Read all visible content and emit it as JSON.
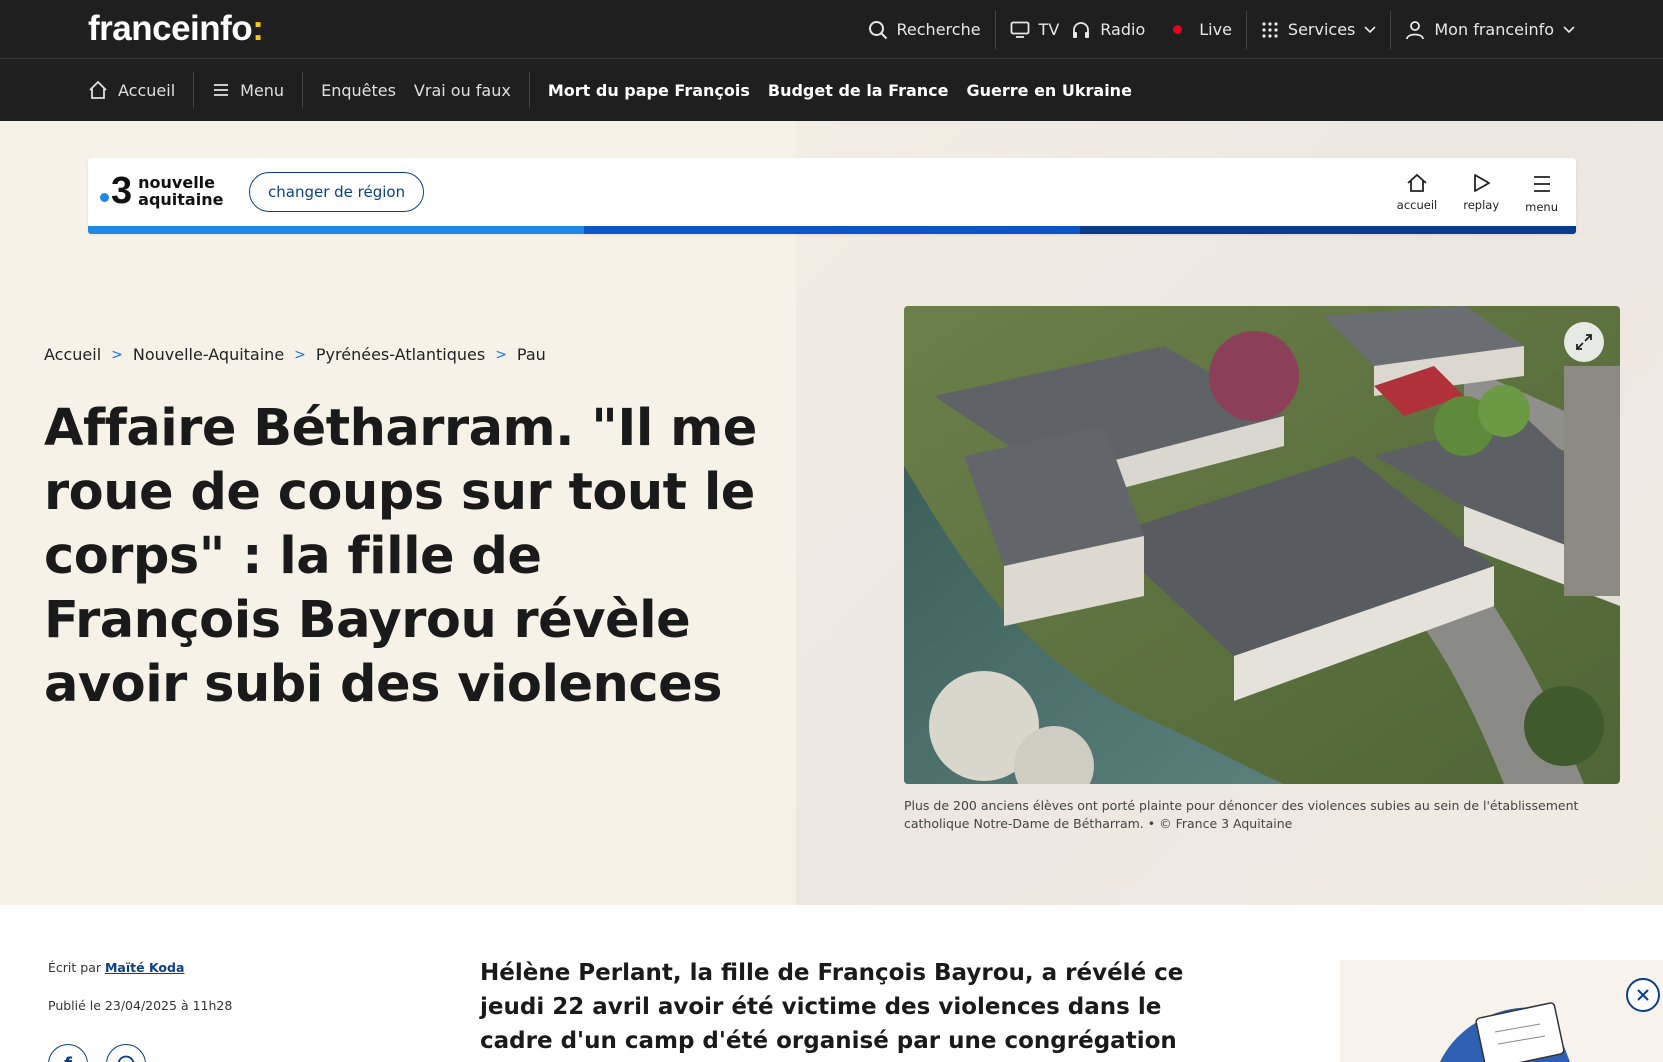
{
  "header": {
    "logo_text": "franceinfo",
    "logo_colon": ":",
    "search_label": "Recherche",
    "tv_label": "TV",
    "radio_label": "Radio",
    "live_label": "Live",
    "services_label": "Services",
    "account_label": "Mon franceinfo"
  },
  "nav": {
    "home": "Accueil",
    "menu": "Menu",
    "items": [
      "Enquêtes",
      "Vrai ou faux"
    ],
    "highlights": [
      "Mort du pape François",
      "Budget de la France",
      "Guerre en Ukraine"
    ]
  },
  "region": {
    "channel_number": "3",
    "name_line1": "nouvelle",
    "name_line2": "aquitaine",
    "change_label": "changer de région",
    "actions": [
      "accueil",
      "replay",
      "menu"
    ],
    "stripe_colors": [
      "#1e88e5",
      "#0b55c7",
      "#0a3a8c"
    ]
  },
  "breadcrumb": [
    "Accueil",
    "Nouvelle-Aquitaine",
    "Pyrénées-Atlantiques",
    "Pau"
  ],
  "article": {
    "title": "Affaire Bétharram. \"Il me roue de coups sur tout le corps\" : la fille de François Bayrou révèle avoir subi des violences",
    "image_caption": "Plus de 200 anciens élèves ont porté plainte pour dénoncer des violences subies au sein de l'établissement catholique Notre-Dame de Bétharram. • © France 3 Aquitaine",
    "author_prefix": "Écrit par",
    "author": "Maïté Koda",
    "published": "Publié le 23/04/2025 à 11h28",
    "lead": "Hélène Perlant, la fille de François Bayrou, a révélé ce jeudi 22 avril avoir été victime des violences dans le cadre d'un camp d'été organisé par une congrégation religieuse, à"
  },
  "share": {
    "facebook": "f"
  },
  "colors": {
    "topbar": "#1f1f1f",
    "accent_blue": "#0b3f8a",
    "live_red": "#e2001a",
    "logo_yellow": "#f5c518"
  }
}
